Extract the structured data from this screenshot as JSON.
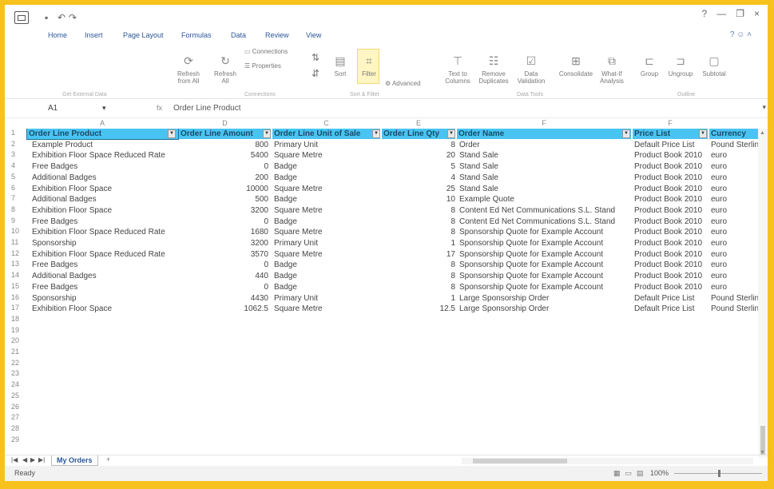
{
  "titlebar": {
    "help": "?",
    "minimize": "—",
    "restore": "❐",
    "close": "×"
  },
  "menu": {
    "tabs": [
      "Home",
      "Insert",
      "Page Layout",
      "Formulas",
      "Data",
      "Review",
      "View"
    ],
    "right_icon": "? ☺ ˄"
  },
  "ribbon": {
    "buttons": [
      {
        "label": "Refresh\nfrom All",
        "icon": "refresh-icon"
      },
      {
        "label": "Refresh\nAll",
        "icon": "refresh-all-icon"
      },
      {
        "label": "Connections",
        "icon": "connections-icon"
      },
      {
        "label": "Properties",
        "icon": "properties-icon"
      },
      {
        "label": "Sort",
        "icon": "sort-icon"
      },
      {
        "label": "Filter",
        "icon": "filter-icon"
      },
      {
        "label": "Advanced",
        "icon": "advanced-filter-icon"
      },
      {
        "label": "Text to\nColumns",
        "icon": "text-to-columns-icon"
      },
      {
        "label": "Remove\nDuplicates",
        "icon": "remove-duplicates-icon"
      },
      {
        "label": "Data\nValidation",
        "icon": "data-validation-icon"
      },
      {
        "label": "Consolidate",
        "icon": "consolidate-icon"
      },
      {
        "label": "What-If\nAnalysis",
        "icon": "what-if-icon"
      },
      {
        "label": "Group",
        "icon": "group-icon"
      },
      {
        "label": "Ungroup",
        "icon": "ungroup-icon"
      },
      {
        "label": "Subtotal",
        "icon": "subtotal-icon"
      }
    ],
    "groups": [
      "Get External Data",
      "Connections",
      "Sort & Filter",
      "Data Tools",
      "Outline"
    ]
  },
  "formula_bar": {
    "name_box": "A1",
    "fx": "fx",
    "formula": "Order Line Product"
  },
  "columns": [
    "A",
    "D",
    "C",
    "E",
    "F",
    "F"
  ],
  "headers": [
    "Order Line Product",
    "Order Line Amount",
    "Order Line Unit of Sale",
    "Order Line Qty",
    "Order Name",
    "Price List",
    "Currency"
  ],
  "rows": [
    [
      "Example Product",
      "800",
      "Primary Unit",
      "8",
      "Order",
      "Default Price List",
      "Pound Sterling"
    ],
    [
      "Exhibition Floor Space Reduced Rate",
      "5400",
      "Square Metre",
      "20",
      "Stand Sale",
      "Product Book 2010",
      "euro"
    ],
    [
      "Free Badges",
      "0",
      "Badge",
      "5",
      "Stand Sale",
      "Product Book 2010",
      "euro"
    ],
    [
      "Additional Badges",
      "200",
      "Badge",
      "4",
      "Stand Sale",
      "Product Book 2010",
      "euro"
    ],
    [
      "Exhibition Floor Space",
      "10000",
      "Square Metre",
      "25",
      "Stand Sale",
      "Product Book 2010",
      "euro"
    ],
    [
      "Additional Badges",
      "500",
      "Badge",
      "10",
      "Example Quote",
      "Product Book 2010",
      "euro"
    ],
    [
      "Exhibition Floor Space",
      "3200",
      "Square Metre",
      "8",
      "Content Ed Net Communications S.L. Stand",
      "Product Book 2010",
      "euro"
    ],
    [
      "Free Badges",
      "0",
      "Badge",
      "8",
      "Content Ed Net Communications S.L. Stand",
      "Product Book 2010",
      "euro"
    ],
    [
      "Exhibition Floor Space Reduced Rate",
      "1680",
      "Square Metre",
      "8",
      "Sponsorship Quote for Example Account",
      "Product Book 2010",
      "euro"
    ],
    [
      "Sponsorship",
      "3200",
      "Primary Unit",
      "1",
      "Sponsorship Quote for Example Account",
      "Product Book 2010",
      "euro"
    ],
    [
      "Exhibition Floor Space Reduced Rate",
      "3570",
      "Square Metre",
      "17",
      "Sponsorship Quote for Example Account",
      "Product Book 2010",
      "euro"
    ],
    [
      "Free Badges",
      "0",
      "Badge",
      "8",
      "Sponsorship Quote for Example Account",
      "Product Book 2010",
      "euro"
    ],
    [
      "Additional Badges",
      "440",
      "Badge",
      "8",
      "Sponsorship Quote for Example Account",
      "Product Book 2010",
      "euro"
    ],
    [
      "Free Badges",
      "0",
      "Badge",
      "8",
      "Sponsorship Quote for Example Account",
      "Product Book 2010",
      "euro"
    ],
    [
      "Sponsorship",
      "4430",
      "Primary Unit",
      "1",
      "Large Sponsorship Order",
      "Default Price List",
      "Pound Sterling"
    ],
    [
      "Exhibition Floor Space",
      "1062.5",
      "Square Metre",
      "12.5",
      "Large Sponsorship Order",
      "Default Price List",
      "Pound Sterling"
    ]
  ],
  "row_numbers": [
    "1",
    "2",
    "3",
    "4",
    "5",
    "6",
    "7",
    "8",
    "9",
    "10",
    "11",
    "12",
    "13",
    "14",
    "15",
    "16",
    "17",
    "18",
    "19",
    "20",
    "21",
    "22",
    "23",
    "24",
    "25",
    "26",
    "27",
    "28",
    "29"
  ],
  "sheet_tabs": {
    "active": "My Orders",
    "add": "+"
  },
  "status": {
    "ready": "Ready",
    "zoom": "100%"
  }
}
